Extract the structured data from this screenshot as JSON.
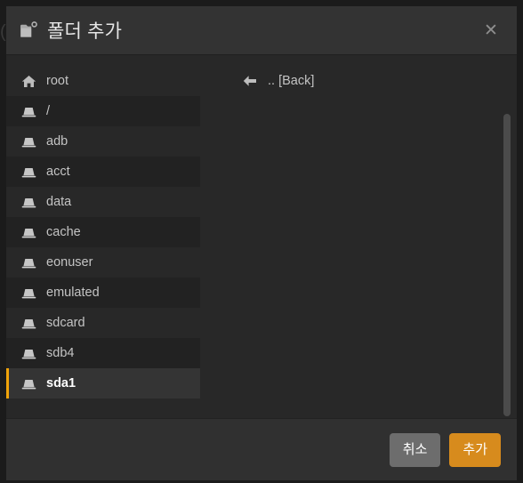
{
  "background": {
    "ghost_glyph": "("
  },
  "dialog": {
    "title": "폴더 추가",
    "title_icon": "folder-add-icon",
    "close_icon": "close-icon",
    "close_glyph": "✕",
    "accent_color": "#f0a30a",
    "header_bg": "#333333",
    "body_bg": "#282828",
    "footer_bg": "#303030"
  },
  "tree": {
    "items": [
      {
        "label": "root",
        "icon": "home-icon",
        "selected": false,
        "striped": false
      },
      {
        "label": "/",
        "icon": "drive-icon",
        "selected": false,
        "striped": true
      },
      {
        "label": "adb",
        "icon": "drive-icon",
        "selected": false,
        "striped": false
      },
      {
        "label": "acct",
        "icon": "drive-icon",
        "selected": false,
        "striped": true
      },
      {
        "label": "data",
        "icon": "drive-icon",
        "selected": false,
        "striped": false
      },
      {
        "label": "cache",
        "icon": "drive-icon",
        "selected": false,
        "striped": true
      },
      {
        "label": "eonuser",
        "icon": "drive-icon",
        "selected": false,
        "striped": false
      },
      {
        "label": "emulated",
        "icon": "drive-icon",
        "selected": false,
        "striped": true
      },
      {
        "label": "sdcard",
        "icon": "drive-icon",
        "selected": false,
        "striped": false
      },
      {
        "label": "sdb4",
        "icon": "drive-icon",
        "selected": false,
        "striped": true
      },
      {
        "label": "sda1",
        "icon": "drive-icon",
        "selected": true,
        "striped": false
      }
    ]
  },
  "file_panel": {
    "back_label": ".. [Back]",
    "back_icon": "arrow-left-icon"
  },
  "footer": {
    "cancel_label": "취소",
    "confirm_label": "추가",
    "cancel_color": "#6d6d6d",
    "confirm_color": "#d78b1d"
  },
  "scrollbar": {
    "thumb_color": "#4b4b4b"
  }
}
